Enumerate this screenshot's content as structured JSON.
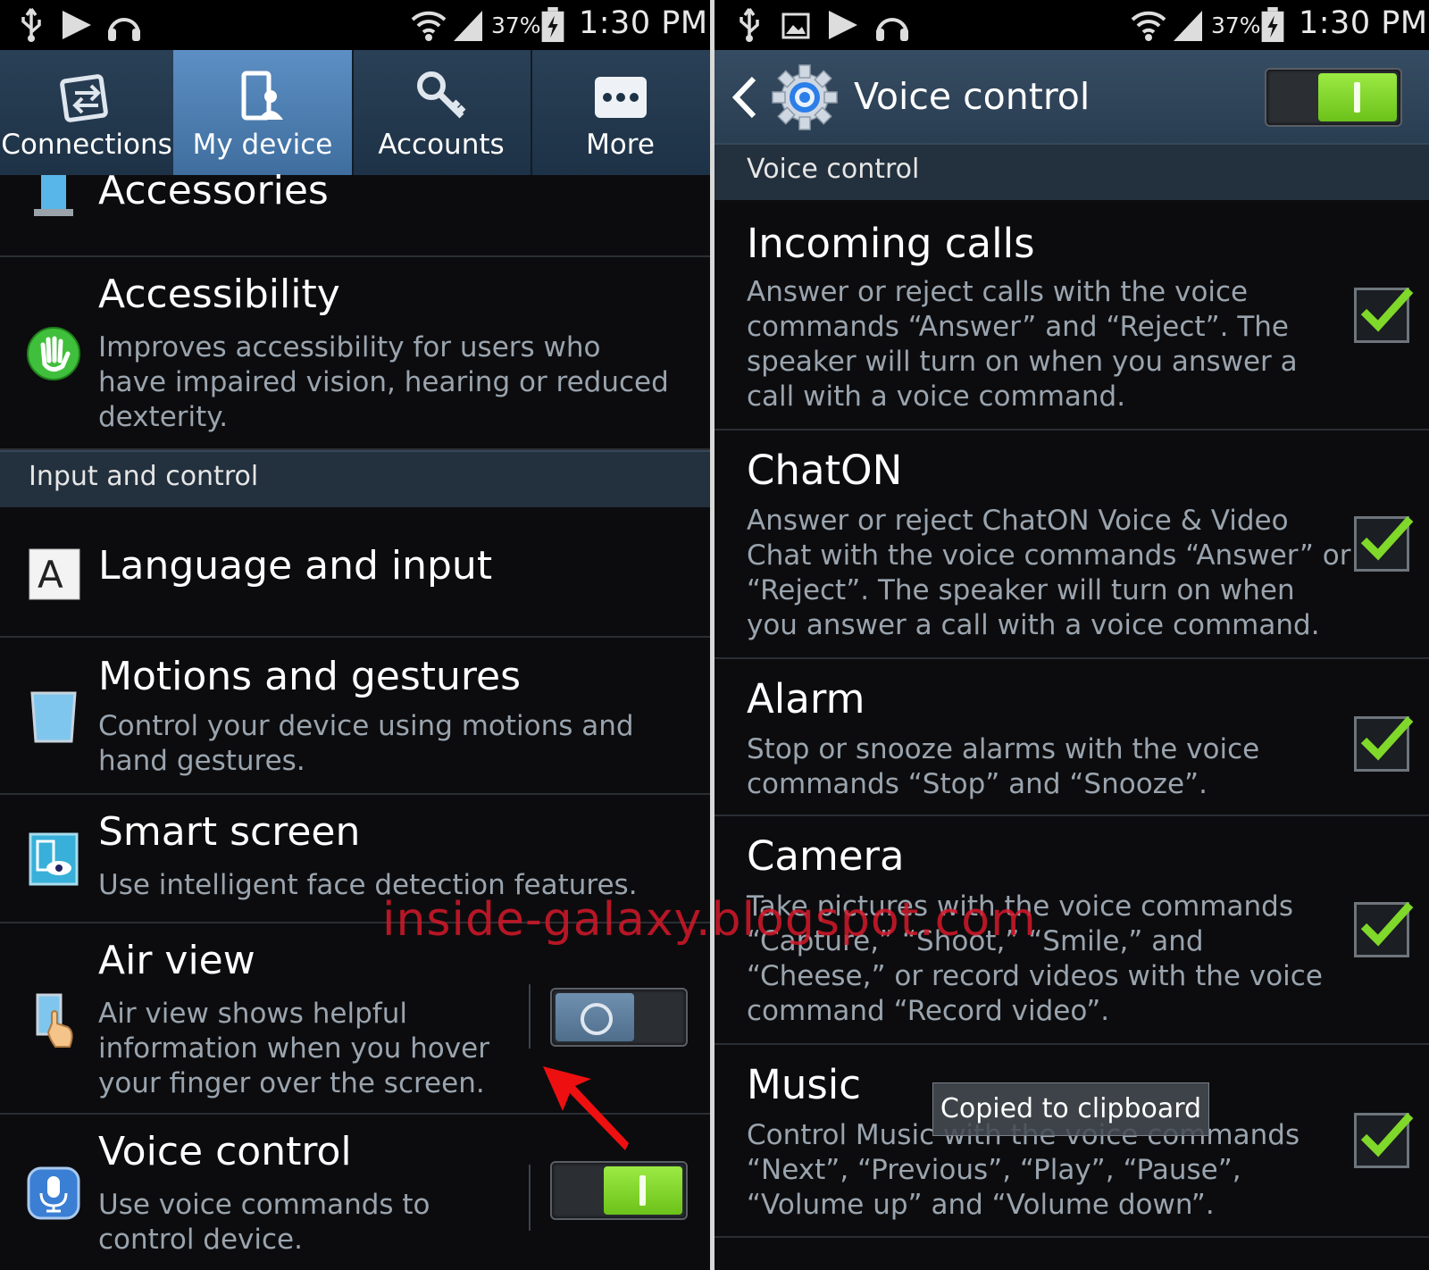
{
  "status": {
    "battery_percent": "37%",
    "time": "1:30 PM"
  },
  "left": {
    "tabs": [
      {
        "label": "Connections"
      },
      {
        "label": "My device"
      },
      {
        "label": "Accounts"
      },
      {
        "label": "More"
      }
    ],
    "rows": {
      "accessories": {
        "title": "Accessories"
      },
      "accessibility": {
        "title": "Accessibility",
        "desc": "Improves accessibility for users who have impaired vision, hearing or reduced dexterity."
      },
      "section_input": "Input and control",
      "language": {
        "title": "Language and input"
      },
      "motions": {
        "title": "Motions and gestures",
        "desc": "Control your device using motions and hand gestures."
      },
      "smart": {
        "title": "Smart screen",
        "desc": "Use intelligent face detection features."
      },
      "airview": {
        "title": "Air view",
        "desc": "Air view shows helpful information when you hover your finger over the screen.",
        "switch_on": false
      },
      "voice": {
        "title": "Voice control",
        "desc": "Use voice commands to control device.",
        "switch_on": true
      }
    }
  },
  "right": {
    "header": {
      "title": "Voice control",
      "switch_on": true
    },
    "section": "Voice control",
    "items": [
      {
        "title": "Incoming calls",
        "desc": "Answer or reject calls with the voice commands “Answer” and “Reject”. The speaker will turn on when you answer a call with a voice command.",
        "checked": true
      },
      {
        "title": "ChatON",
        "desc": "Answer or reject ChatON Voice & Video Chat with the voice commands “Answer” or “Reject”. The speaker will turn on when you answer a call with a voice command.",
        "checked": true
      },
      {
        "title": "Alarm",
        "desc": "Stop or snooze alarms with the voice commands “Stop” and “Snooze”.",
        "checked": true
      },
      {
        "title": "Camera",
        "desc": "Take pictures with the voice commands “Capture,” “Shoot,” “Smile,” and “Cheese,” or record videos with the voice command “Record video”.",
        "checked": true
      },
      {
        "title": "Music",
        "desc": "Control Music with the voice commands “Next”, “Previous”, “Play”, “Pause”, “Volume up” and “Volume down”.",
        "checked": true
      }
    ],
    "toast": "Copied to clipboard"
  },
  "watermark": "inside-galaxy.blogspot.com",
  "colors": {
    "accent_green": "#7fd82a",
    "tab_active": "#4f80b2",
    "section_bg": "#23303d"
  }
}
